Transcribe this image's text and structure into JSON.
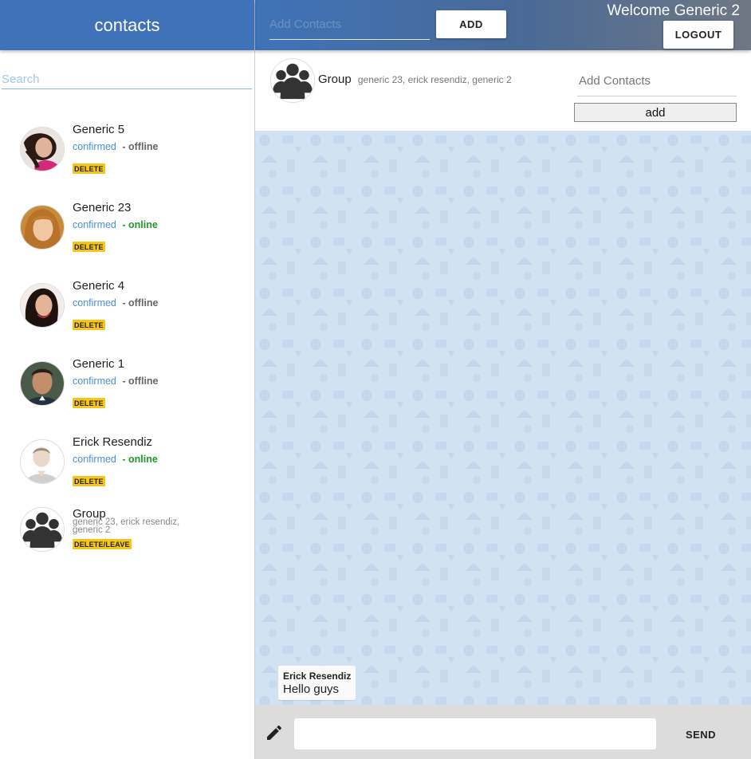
{
  "sidebar": {
    "title": "contacts",
    "search_placeholder": "Search",
    "contacts": [
      {
        "name": "Generic 5",
        "status": "confirmed",
        "presence": "- offline",
        "action": "DELETE"
      },
      {
        "name": "Generic 23",
        "status": "confirmed",
        "presence": "- online",
        "action": "DELETE"
      },
      {
        "name": "Generic 4",
        "status": "confirmed",
        "presence": "- offline",
        "action": "DELETE"
      },
      {
        "name": "Generic 1",
        "status": "confirmed",
        "presence": "- offline",
        "action": "DELETE"
      },
      {
        "name": "Erick Resendiz",
        "status": "confirmed",
        "presence": "- online",
        "action": "DELETE"
      }
    ],
    "group": {
      "name": "Group",
      "members": "generic 23, erick resendiz, generic 2",
      "action": "DELETE/LEAVE"
    }
  },
  "topbar": {
    "add_contacts_placeholder": "Add Contacts",
    "add_label": "ADD",
    "welcome": "Welcome Generic 2",
    "logout_label": "LOGOUT"
  },
  "chat_header": {
    "title": "Group",
    "members": "generic 23, erick resendiz, generic 2",
    "add_contacts_placeholder": "Add Contacts",
    "add_label": "add"
  },
  "messages": [
    {
      "sender": "Erick Resendiz",
      "text": "Hello guys"
    }
  ],
  "composer": {
    "send_label": "SEND"
  },
  "colors": {
    "accent": "#3f72b8",
    "online": "#1f9a2a",
    "offline": "#666666",
    "confirmed": "#4a8fd6",
    "badge": "#f5c518",
    "chat_bg": "#d2e2f3"
  }
}
